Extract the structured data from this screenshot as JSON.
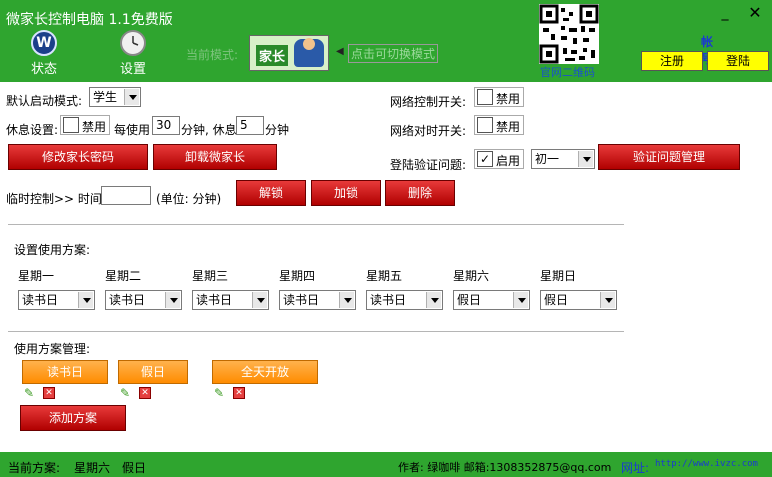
{
  "window": {
    "title": "微家长控制电脑 1.1免费版",
    "min_label": "_",
    "close_label": "✕"
  },
  "nav": {
    "status_label": "状态",
    "settings_label": "设置",
    "status_icon": "W"
  },
  "mode": {
    "label": "当前模式:",
    "value": "家长",
    "switch_label": "点击可切换模式",
    "arrow": "◀"
  },
  "qr": {
    "caption": "官网二维码"
  },
  "account": {
    "label": "帐号:Admin",
    "register_label": "注册",
    "login_label": "登陆"
  },
  "settings": {
    "default_mode_label": "默认启动模式:",
    "default_mode_value": "学生",
    "network_switch_label": "网络控制开关:",
    "network_switch_disable": "禁用",
    "rest_label": "休息设置:",
    "rest_disable": "禁用",
    "rest_every_label": "每使用",
    "rest_every_value": "30",
    "rest_minutes_label": "分钟, 休息",
    "rest_break_value": "5",
    "rest_minutes_label2": "分钟",
    "network_timer_label": "网络对时开关:",
    "network_timer_disable": "禁用",
    "change_pwd_label": "修改家长密码",
    "uninstall_label": "卸载微家长",
    "login_q_label": "登陆验证问题:",
    "login_q_enable": "启用",
    "login_q_check": "✓",
    "login_q_value": "初一",
    "login_q_manage": "验证问题管理",
    "temp_control_label": "临时控制>> 时间:",
    "temp_unit": "(单位: 分钟)",
    "unlock_label": "解锁",
    "lock_label": "加锁",
    "delete_label": "删除"
  },
  "schedule": {
    "title": "设置使用方案:",
    "days": [
      {
        "name": "星期一",
        "plan": "读书日"
      },
      {
        "name": "星期二",
        "plan": "读书日"
      },
      {
        "name": "星期三",
        "plan": "读书日"
      },
      {
        "name": "星期四",
        "plan": "读书日"
      },
      {
        "name": "星期五",
        "plan": "读书日"
      },
      {
        "name": "星期六",
        "plan": "假日"
      },
      {
        "name": "星期日",
        "plan": "假日"
      }
    ]
  },
  "plans": {
    "title": "使用方案管理:",
    "items": [
      {
        "name": "读书日"
      },
      {
        "name": "假日"
      },
      {
        "name": "全天开放"
      }
    ],
    "add_label": "添加方案",
    "edit_icon": "pencil-icon",
    "delete_icon": "delete-icon"
  },
  "footer": {
    "current_label": "当前方案:",
    "current_day": "星期六",
    "current_plan": "假日",
    "author": "作者: 绿咖啡 邮箱:1308352875@qq.com",
    "site_label": "网址:",
    "site_url": "http://www.ivzc.com"
  },
  "colors": {
    "header": "#2fa52f",
    "button_red": "#d01010",
    "button_orange": "#ff9a1a",
    "account": "#1a3ad0"
  }
}
